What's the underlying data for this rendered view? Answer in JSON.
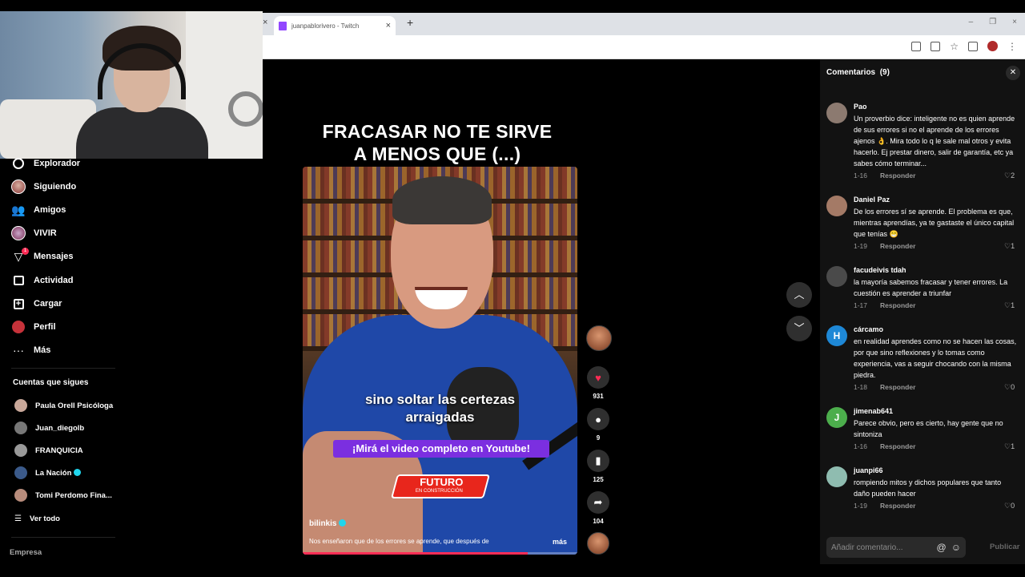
{
  "browser": {
    "tab_title": "juanpablorivero - Twitch",
    "tab_close": "×",
    "new_tab": "+",
    "window_controls": [
      "–",
      "❐",
      "×"
    ]
  },
  "sidebar": {
    "nav": [
      {
        "label": "Explorador",
        "icon": "compass-icon"
      },
      {
        "label": "Siguiendo",
        "icon": "following-avatar-icon"
      },
      {
        "label": "Amigos",
        "icon": "friends-icon"
      },
      {
        "label": "VIVIR",
        "icon": "live-icon"
      },
      {
        "label": "Mensajes",
        "icon": "messages-icon",
        "badge": "1"
      },
      {
        "label": "Actividad",
        "icon": "activity-icon"
      },
      {
        "label": "Cargar",
        "icon": "upload-icon"
      },
      {
        "label": "Perfil",
        "icon": "profile-icon"
      },
      {
        "label": "Más",
        "icon": "more-icon"
      }
    ],
    "following_title": "Cuentas que sigues",
    "following": [
      {
        "label": "Paula Orell Psicóloga",
        "verified": false
      },
      {
        "label": "Juan_diegolb",
        "verified": false
      },
      {
        "label": "FRANQUICIA",
        "verified": false
      },
      {
        "label": "La Nación",
        "verified": true
      },
      {
        "label": "Tomi Perdomo Fina...",
        "verified": false
      }
    ],
    "see_all": "Ver todo",
    "footer": "Empresa"
  },
  "video": {
    "title_line1": "FRACASAR NO TE SIRVE",
    "title_line2": "A MENOS QUE (...)",
    "subtitle_line1": "sino soltar las certezas",
    "subtitle_line2": "arraigadas",
    "cta": "¡Mirá el video completo en Youtube!",
    "logo_main": "FUTURO",
    "logo_sub": "EN CONSTRUCCIÓN",
    "author": "bilinkis",
    "caption": "Nos enseñaron que de los errores se aprende, que después de",
    "more": "más",
    "progress": 0.82
  },
  "actions": {
    "likes": "931",
    "comments": "9",
    "saves": "125",
    "shares": "104",
    "like_color": "#fe2c55"
  },
  "comments_panel": {
    "title": "Comentarios",
    "count": "(9)",
    "reply_label": "Responder",
    "placeholder": "Añadir comentario...",
    "publish": "Publicar",
    "items": [
      {
        "user": "Pao",
        "avatar": "",
        "text": "Un proverbio dice: inteligente no es quien aprende de sus errores si no el aprende de los errores ajenos 👌. Mira todo lo q le sale mal otros y evita hacerlo. Ej prestar dinero, salir de garantía, etc ya sabes cómo terminar...",
        "date": "1-16",
        "likes": "2"
      },
      {
        "user": "Daniel Paz",
        "avatar": "",
        "text": "De los errores sí se aprende. El problema es que, mientras aprendías, ya te gastaste el único capital que tenías 😁",
        "date": "1-19",
        "likes": "1"
      },
      {
        "user": "facudeivis tdah",
        "avatar": "",
        "text": "la mayoría sabemos fracasar y tener errores. La cuestión es aprender a triunfar",
        "date": "1-17",
        "likes": "1"
      },
      {
        "user": "cárcamo",
        "avatar": "H",
        "text": "en realidad aprendes como no se hacen las cosas, por que sino reflexiones y lo tomas como experiencia, vas a seguir chocando con la misma piedra.",
        "date": "1-18",
        "likes": "0"
      },
      {
        "user": "jimenab641",
        "avatar": "J",
        "text": "Parece obvio, pero es cierto, hay gente que no sintoniza",
        "date": "1-16",
        "likes": "1"
      },
      {
        "user": "juanpi66",
        "avatar": "",
        "text": "rompiendo mitos y dichos populares que tanto daño pueden hacer",
        "date": "1-19",
        "likes": "0"
      }
    ]
  }
}
